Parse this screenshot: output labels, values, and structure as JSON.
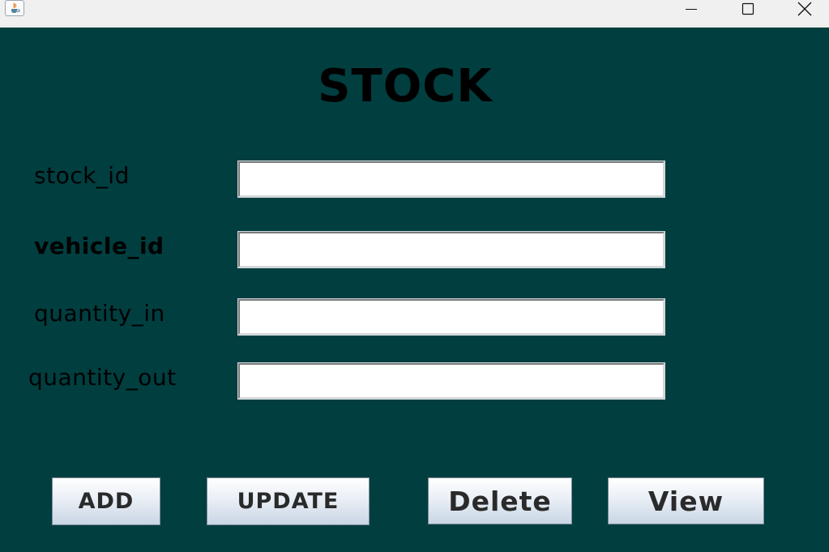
{
  "window": {
    "icon": "java-cup-icon",
    "controls": [
      "minimize-icon",
      "maximize-icon",
      "close-icon"
    ]
  },
  "form": {
    "title": "STOCK",
    "fields": [
      {
        "label": "stock_id",
        "value": ""
      },
      {
        "label": "vehicle_id",
        "value": ""
      },
      {
        "label": "quantity_in",
        "value": ""
      },
      {
        "label": "quantity_out",
        "value": ""
      }
    ]
  },
  "buttons": {
    "add": "ADD",
    "update": "UPDATE",
    "delete": "Delete",
    "view": "View"
  },
  "colors": {
    "background": "#013e40",
    "titlebar": "#f0f0f0"
  }
}
